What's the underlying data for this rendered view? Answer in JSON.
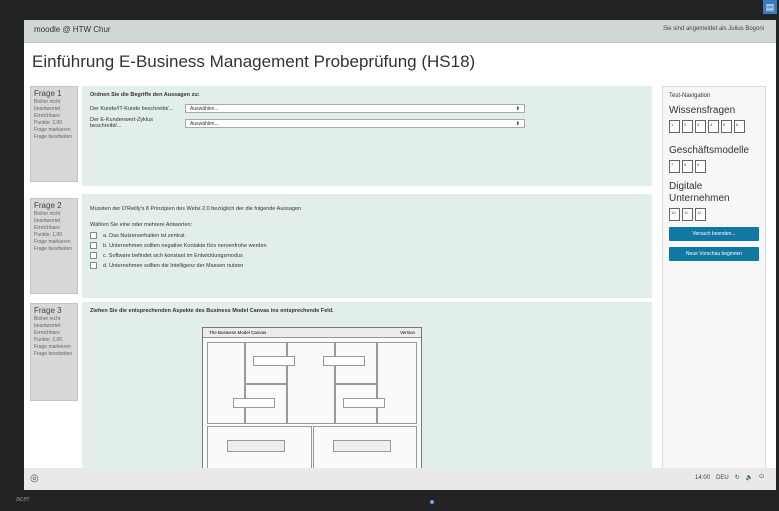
{
  "topbar": {
    "brand": "moodle @ HTW Chur",
    "login": "Sie sind angemeldet als Julius Bogoni"
  },
  "page_title": "Einführung E-Business Management Probeprüfung (HS18)",
  "questions": [
    {
      "num": "Frage 1",
      "status": "Bisher nicht beantwortet",
      "points": "Erreichbare Punkte: 2,00",
      "flag": "Frage markieren",
      "edit": "Frage bearbeiten",
      "lead": "Ordnen Sie die Begriffe den Aussagen zu:",
      "rows": [
        {
          "label": "Der Kunde/IT-Kunde beschreibt/...",
          "select": "Auswählen..."
        },
        {
          "label": "Der E-Kundenwert-Zyklus beschreibt/...",
          "select": "Auswählen..."
        }
      ]
    },
    {
      "num": "Frage 2",
      "status": "Bisher nicht beantwortet",
      "points": "Erreichbare Punkte: 1,00",
      "flag": "Frage markieren",
      "edit": "Frage bearbeiten",
      "lead": "Mussten der O'Reilly's 8 Prinzipien des Webs 2.0 bezüglich der die folgende Aussagen",
      "sub": "Wählen Sie eine oder mehrere Antworten:",
      "options": [
        "a. Das Nutzerverhalten ist zentral.",
        "b. Unternehmen sollten negative Kontakte fürs nervenfrohe werden",
        "c. Software befindet sich konstant im Entwicklungsmodus",
        "d. Unternehmen sollten die Intelligenz der Massen nutzen"
      ]
    },
    {
      "num": "Frage 3",
      "status": "Bisher nicht beantwortet",
      "points": "Erreichbare Punkte: 2,00",
      "flag": "Frage markieren",
      "edit": "Frage bearbeiten",
      "lead": "Ziehen Sie die entsprechenden Aspekte des Business Model Canvas ins entsprechende Feld.",
      "canvas_title": "The Business Model Canvas",
      "canvas_right": "Version"
    }
  ],
  "nav": {
    "title": "Test-Navigation",
    "sections": [
      {
        "name": "Wissensfragen",
        "boxes": [
          "1",
          "2",
          "3",
          "4",
          "5",
          "6"
        ]
      },
      {
        "name": "Geschäftsmodelle",
        "boxes": [
          "7",
          "8",
          "9"
        ]
      },
      {
        "name": "Digitale Unternehmen",
        "boxes": [
          "10",
          "11",
          "12"
        ]
      }
    ],
    "finish": "Versuch beenden...",
    "preview": "Neue Vorschau beginnen"
  },
  "taskbar": {
    "time": "14:00",
    "lang": "DEU"
  },
  "monitor_brand": "acer"
}
